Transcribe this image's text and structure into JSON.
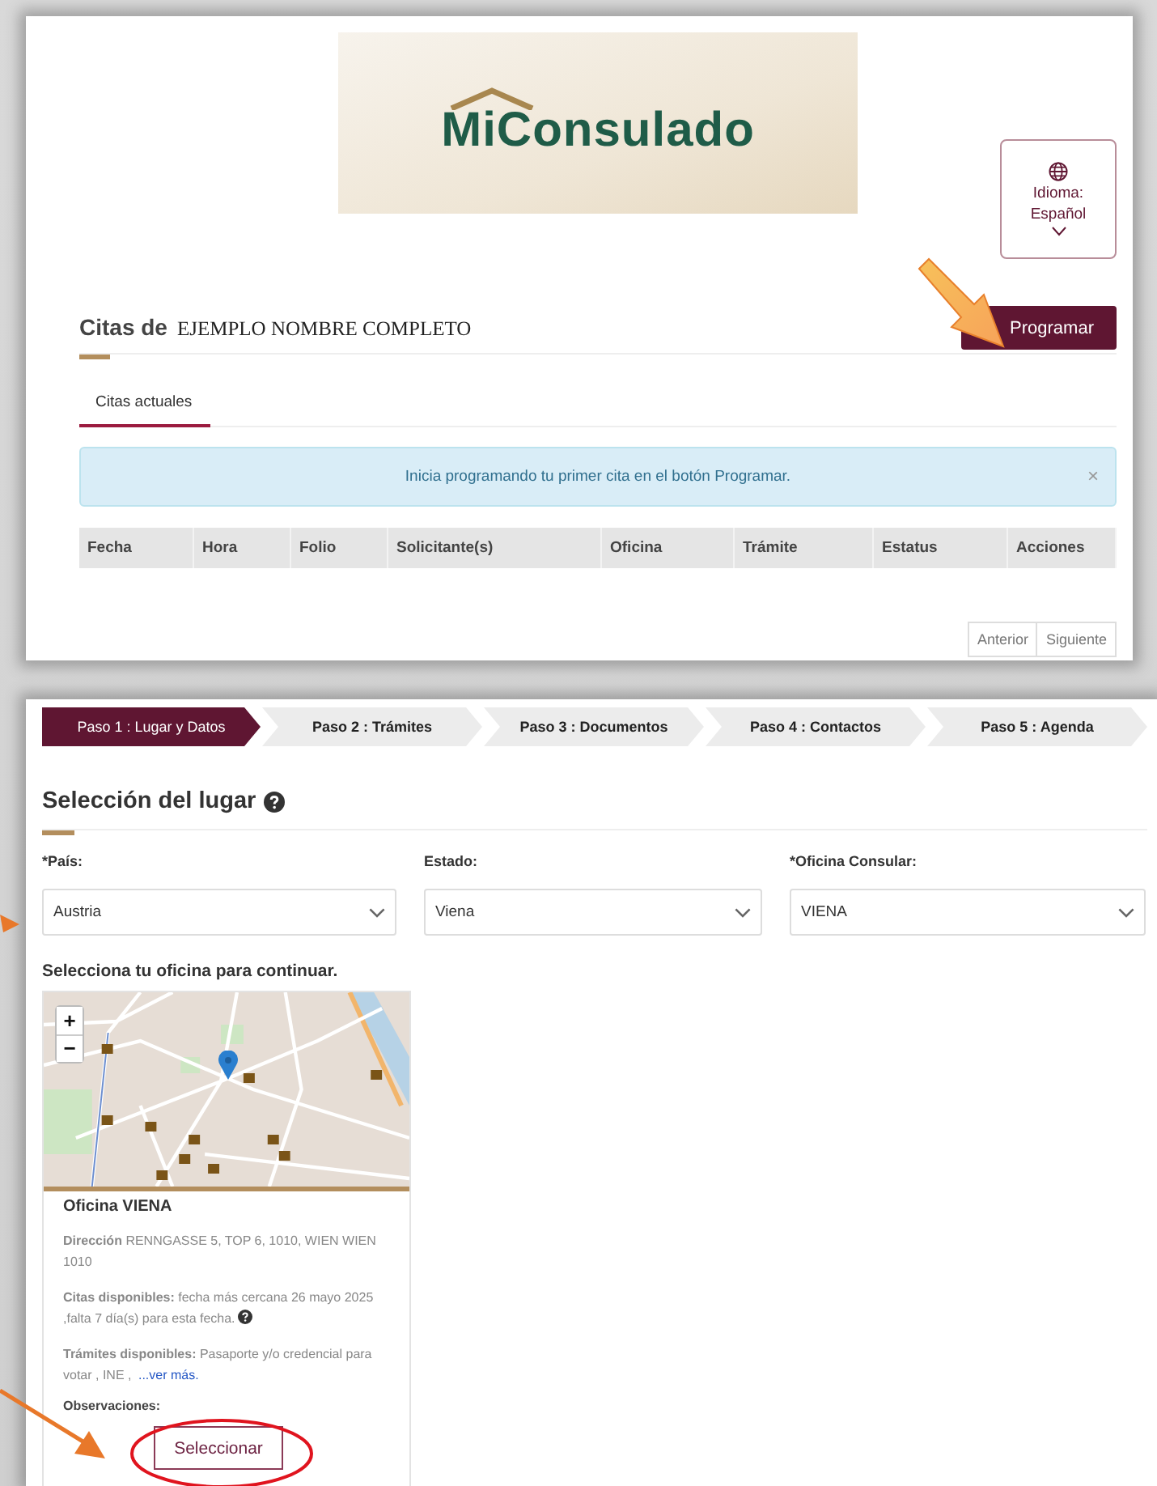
{
  "header": {
    "logo_text": "**Mi**Consulado",
    "language_button": {
      "label": "Idioma:",
      "value": "Español"
    }
  },
  "appointments": {
    "title": "Citas de",
    "name": "EJEMPLO NOMBRE COMPLETO",
    "program_button": "Programar",
    "tabs": [
      {
        "label": "Citas actuales",
        "selected": true
      }
    ],
    "alert": {
      "text": "Inicia programando tu primer cita en el botón Programar.",
      "close": "×"
    },
    "table": {
      "columns": [
        "Fecha",
        "Hora",
        "Folio",
        "Solicitante(s)",
        "Oficina",
        "Trámite",
        "Estatus",
        "Acciones"
      ]
    },
    "pagination": [
      "Anterior",
      "Siguiente"
    ]
  },
  "wizard": {
    "steps": [
      {
        "label": "Paso 1 : Lugar y Datos",
        "selected": true
      },
      {
        "label": "Paso 2 : Trámites",
        "selected": false
      },
      {
        "label": "Paso 3 : Documentos",
        "selected": false
      },
      {
        "label": "Paso 4 : Contactos",
        "selected": false
      },
      {
        "label": "Paso 5 : Agenda",
        "selected": false
      }
    ],
    "heading": "Selección del lugar",
    "fields": [
      {
        "label": "*País:",
        "value": "Austria"
      },
      {
        "label": "Estado:",
        "value": "Viena"
      },
      {
        "label": "*Oficina Consular:",
        "value": "VIENA"
      }
    ],
    "prompt": "Selecciona tu oficina para continuar.",
    "office_card": {
      "map_zoom": [
        "+",
        "−"
      ],
      "title": "Oficina VIENA",
      "details": [
        {
          "text": "**Dirección** RENNGASSE 5, TOP 6, 1010, WIEN WIEN 1010"
        },
        {
          "text": "**Citas disponibles:** fecha más cercana 26 mayo 2025 ,falta 7 día(s) para esta fecha.",
          "help": true
        },
        {
          "text": "**Trámites disponibles:** Pasaporte y/o credencial para votar ,  INE , ",
          "link": "...ver más."
        }
      ],
      "observations": "Observaciones:",
      "select_button": "Seleccionar"
    }
  }
}
